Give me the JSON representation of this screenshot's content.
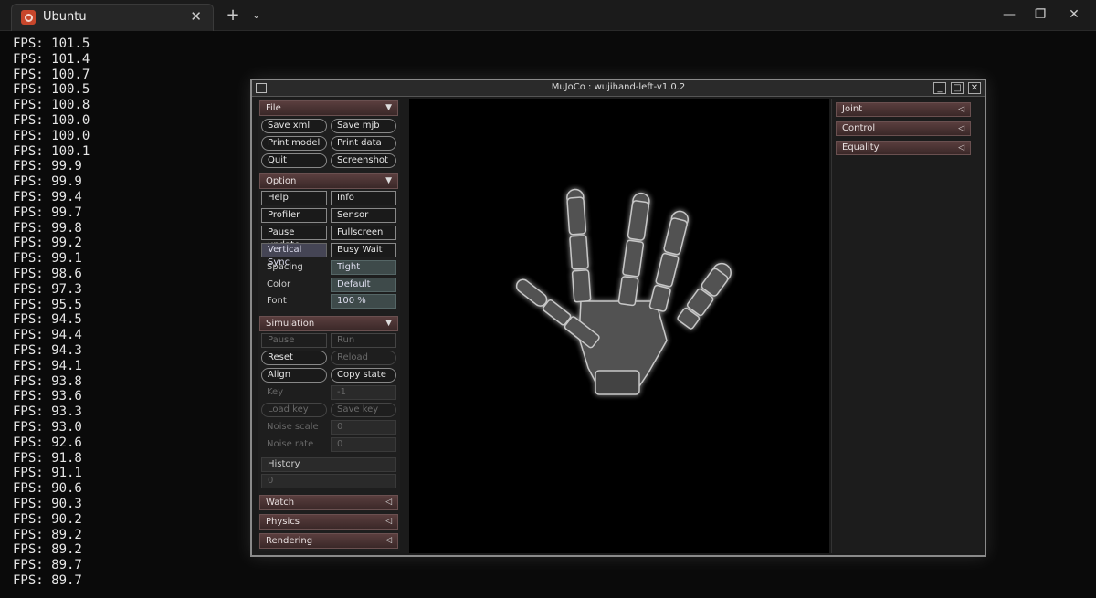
{
  "terminal_window": {
    "tab_title": "Ubuntu",
    "tab_close": "✕",
    "new_tab": "+",
    "dropdown": "⌄",
    "minimize": "—",
    "maximize": "❐",
    "close": "✕"
  },
  "terminal": {
    "lines": [
      "FPS: 101.5",
      "FPS: 101.4",
      "FPS: 100.7",
      "FPS: 100.5",
      "FPS: 100.8",
      "FPS: 100.0",
      "FPS: 100.0",
      "FPS: 100.1",
      "FPS: 99.9",
      "FPS: 99.9",
      "FPS: 99.4",
      "FPS: 99.7",
      "FPS: 99.8",
      "FPS: 99.2",
      "FPS: 99.1",
      "FPS: 98.6",
      "FPS: 97.3",
      "FPS: 95.5",
      "FPS: 94.5",
      "FPS: 94.4",
      "FPS: 94.3",
      "FPS: 94.1",
      "FPS: 93.8",
      "FPS: 93.6",
      "FPS: 93.3",
      "FPS: 93.0",
      "FPS: 92.6",
      "FPS: 91.8",
      "FPS: 91.1",
      "FPS: 90.6",
      "FPS: 90.3",
      "FPS: 90.2",
      "FPS: 89.2",
      "FPS: 89.2",
      "FPS: 89.7",
      "FPS: 89.7"
    ]
  },
  "mujoco": {
    "title": "MuJoCo : wujihand-left-v1.0.2",
    "file": {
      "header": "File",
      "save_xml": "Save xml",
      "save_mjb": "Save mjb",
      "print_model": "Print model",
      "print_data": "Print data",
      "quit": "Quit",
      "screenshot": "Screenshot"
    },
    "option": {
      "header": "Option",
      "help": "Help",
      "info": "Info",
      "profiler": "Profiler",
      "sensor": "Sensor",
      "pause_update": "Pause update",
      "fullscreen": "Fullscreen",
      "vertical_sync": "Vertical Sync",
      "busy_wait": "Busy Wait",
      "spacing_label": "Spacing",
      "spacing_value": "Tight",
      "color_label": "Color",
      "color_value": "Default",
      "font_label": "Font",
      "font_value": "100 %"
    },
    "simulation": {
      "header": "Simulation",
      "pause": "Pause",
      "run": "Run",
      "reset": "Reset",
      "reload": "Reload",
      "align": "Align",
      "copy_state": "Copy state",
      "key_label": "Key",
      "key_value": "-1",
      "load_key": "Load key",
      "save_key": "Save key",
      "noise_scale_label": "Noise scale",
      "noise_scale_value": "0",
      "noise_rate_label": "Noise rate",
      "noise_rate_value": "0",
      "history_label": "History",
      "history_value": "0"
    },
    "collapsed_left": {
      "watch": "Watch",
      "physics": "Physics",
      "rendering": "Rendering"
    },
    "right": {
      "joint": "Joint",
      "control": "Control",
      "equality": "Equality"
    },
    "arrow_down": "▼",
    "arrow_left": "◁"
  }
}
